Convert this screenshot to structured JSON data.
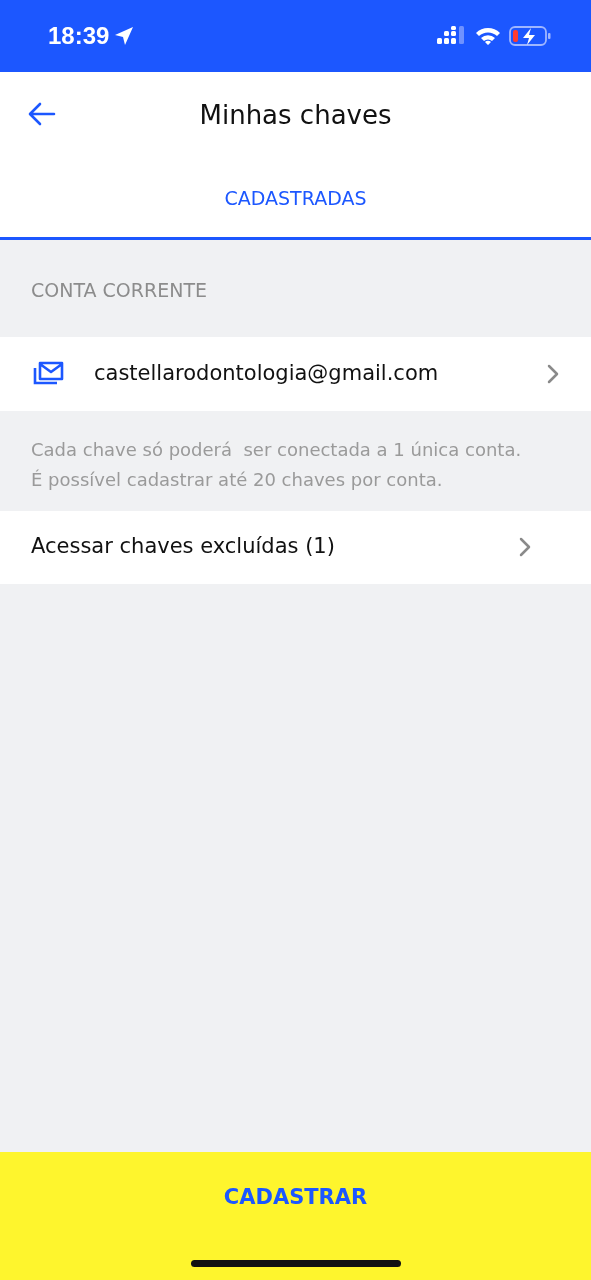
{
  "status_bar": {
    "time": "18:39"
  },
  "header": {
    "title": "Minhas chaves"
  },
  "tabs": [
    {
      "label": "CADASTRADAS",
      "selected": true
    }
  ],
  "section": {
    "title": "CONTA CORRENTE"
  },
  "keys": [
    {
      "kind": "email",
      "value": "castellarodontologia@gmail.com"
    }
  ],
  "note": "Cada chave só poderá  ser conectada a 1 única conta.\nÉ possível cadastrar até 20 chaves por conta.",
  "deleted_link": {
    "label": "Acessar chaves excluídas (1)"
  },
  "primary_button": {
    "label": "CADASTRAR"
  }
}
